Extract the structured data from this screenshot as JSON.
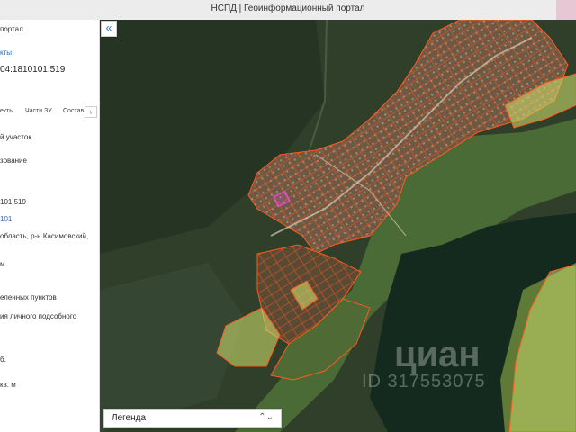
{
  "window": {
    "title": "НСПД | Геоинформационный портал"
  },
  "sidebar": {
    "portal": "портал",
    "link": "кты",
    "cadastral": "04:1810101:519",
    "tabs": [
      "екты",
      "Части ЗУ",
      "Состав"
    ],
    "tab_more": "›",
    "lines": [
      "й участок",
      "зование",
      "101:519",
      "101",
      "область, р-н Касимовский,",
      "м",
      "еленных пунктов",
      "ия личного подсобного",
      "б.",
      "кв. м"
    ]
  },
  "map": {
    "collapse_label": "«",
    "legend_label": "Легенда",
    "legend_arrow": "⌃⌄",
    "watermark": {
      "brand": "циан",
      "id": "ID 317553075"
    },
    "colors": {
      "forest": "#2f3f29",
      "river": "#142a1f",
      "village": "#6b5a44",
      "parcel_outline": "#ff5a1f",
      "highlight": "#d94fc8",
      "field": "#c8d96a"
    }
  }
}
